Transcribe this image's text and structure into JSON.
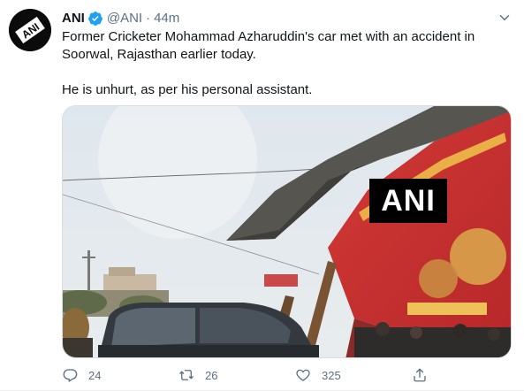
{
  "tweet": {
    "author": {
      "name": "ANI",
      "handle": "@ANI",
      "separator": "·",
      "time": "44m",
      "verified": true,
      "avatar_icon": "ani-logo-icon",
      "avatar_logo_text": "ANI"
    },
    "text": {
      "paragraph_1": "Former Cricketer Mohammad Azharuddin's car met with an accident in Soorwal, Rajasthan earlier today.",
      "paragraph_2": "He is unhurt, as per his personal assistant."
    },
    "media": {
      "watermark": "ANI",
      "signage_colors": {
        "banner": "#c8322f",
        "canopy": "#5a5a57",
        "sky": "#dfe6ec"
      }
    },
    "actions": {
      "reply_icon": "reply-icon",
      "reply_count": "24",
      "retweet_icon": "retweet-icon",
      "retweet_count": "26",
      "like_icon": "heart-icon",
      "like_count": "325",
      "share_icon": "share-icon"
    },
    "colors": {
      "text_primary": "#0f1419",
      "text_secondary": "#5b7083",
      "verified_badge": "#1da1f2"
    }
  }
}
